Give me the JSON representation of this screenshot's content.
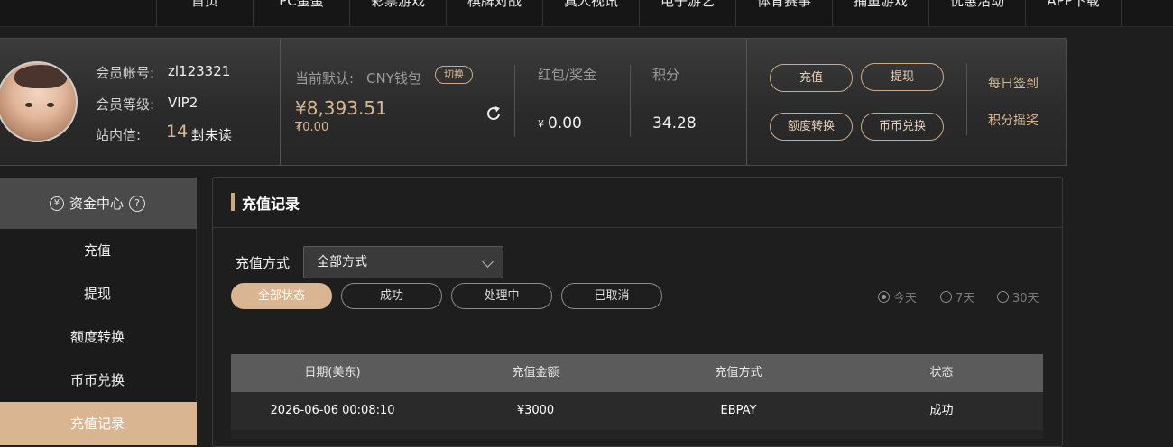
{
  "nav": [
    "首页",
    "PC蛋蛋",
    "彩票游戏",
    "棋牌对战",
    "真人视讯",
    "电子游艺",
    "体育赛事",
    "捕鱼游戏",
    "优惠活动",
    "APP下载"
  ],
  "account": {
    "member_label": "会员帐号:",
    "member_value": "zl123321",
    "level_label": "会员等级:",
    "level_value": "VIP2",
    "inbox_label": "站内信:",
    "inbox_count": "14",
    "inbox_suffix": "封未读"
  },
  "wallet": {
    "default_label": "当前默认:",
    "default_value": "CNY钱包",
    "switch_label": "切换",
    "balance": "¥8,393.51",
    "sub_balance": "₮0.00"
  },
  "bonus": {
    "label": "红包/奖金",
    "currency": "¥",
    "value": "0.00"
  },
  "points": {
    "label": "积分",
    "value": "34.28"
  },
  "actions": {
    "deposit": "充值",
    "withdraw": "提现",
    "transfer": "额度转换",
    "exchange": "币币兑换",
    "daily_checkin": "每日签到",
    "points_lottery": "积分摇奖"
  },
  "sidebar": {
    "header": "资金中心",
    "items": [
      "充值",
      "提现",
      "额度转换",
      "币币兑换",
      "充值记录"
    ],
    "active_index": 4
  },
  "main": {
    "title": "充值记录",
    "method_label": "充值方式",
    "method_selected": "全部方式",
    "status_filters": [
      "全部状态",
      "成功",
      "处理中",
      "已取消"
    ],
    "range_options": [
      "今天",
      "7天",
      "30天"
    ],
    "range_selected": 0,
    "table": {
      "headers": [
        "日期(美东)",
        "充值金额",
        "充值方式",
        "状态"
      ],
      "rows": [
        [
          "2026-06-06 00:08:10",
          "¥3000",
          "EBPAY",
          "成功"
        ]
      ]
    }
  },
  "colors": {
    "accent": "#d9b591",
    "panel": "#2e2e2e",
    "background": "#1e1e1e"
  }
}
